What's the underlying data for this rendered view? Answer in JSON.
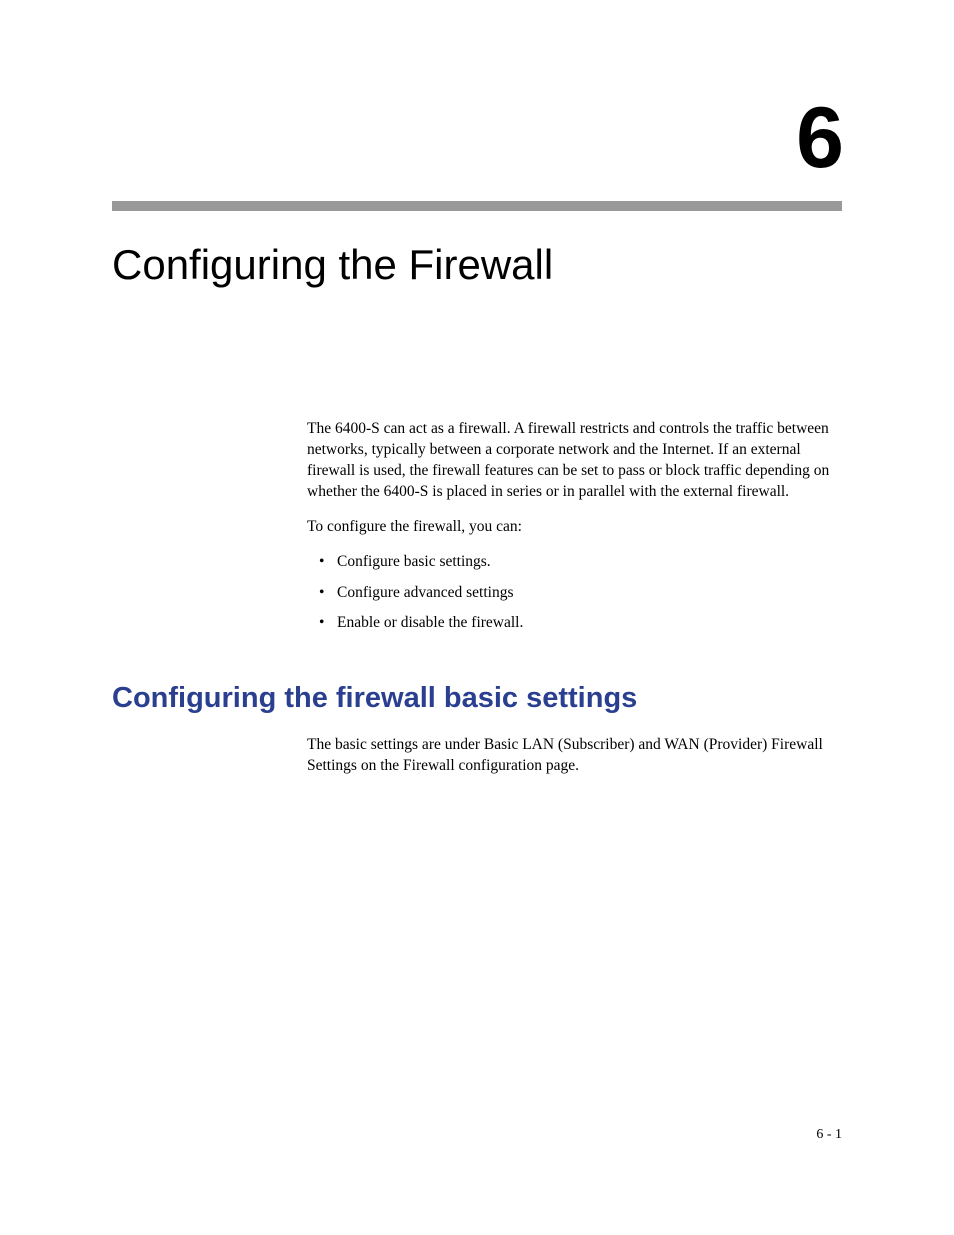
{
  "chapter": {
    "number": "6",
    "title": "Configuring the Firewall"
  },
  "intro": {
    "paragraph1": "The 6400-S can act as a firewall. A firewall restricts and controls the traffic between networks, typically between a corporate network and the Internet. If an external firewall is used, the firewall features can be set to pass or block traffic depending on whether the 6400-S is placed in series or in parallel with the external firewall.",
    "paragraph2": "To configure the firewall, you can:",
    "bullets": [
      "Configure basic settings.",
      "Configure advanced settings",
      "Enable or disable the firewall."
    ]
  },
  "section": {
    "heading": "Configuring the firewall basic settings",
    "paragraph": "The basic settings are under Basic LAN (Subscriber) and WAN (Provider) Firewall Settings on the Firewall configuration page."
  },
  "footer": {
    "page": "6 - 1"
  }
}
